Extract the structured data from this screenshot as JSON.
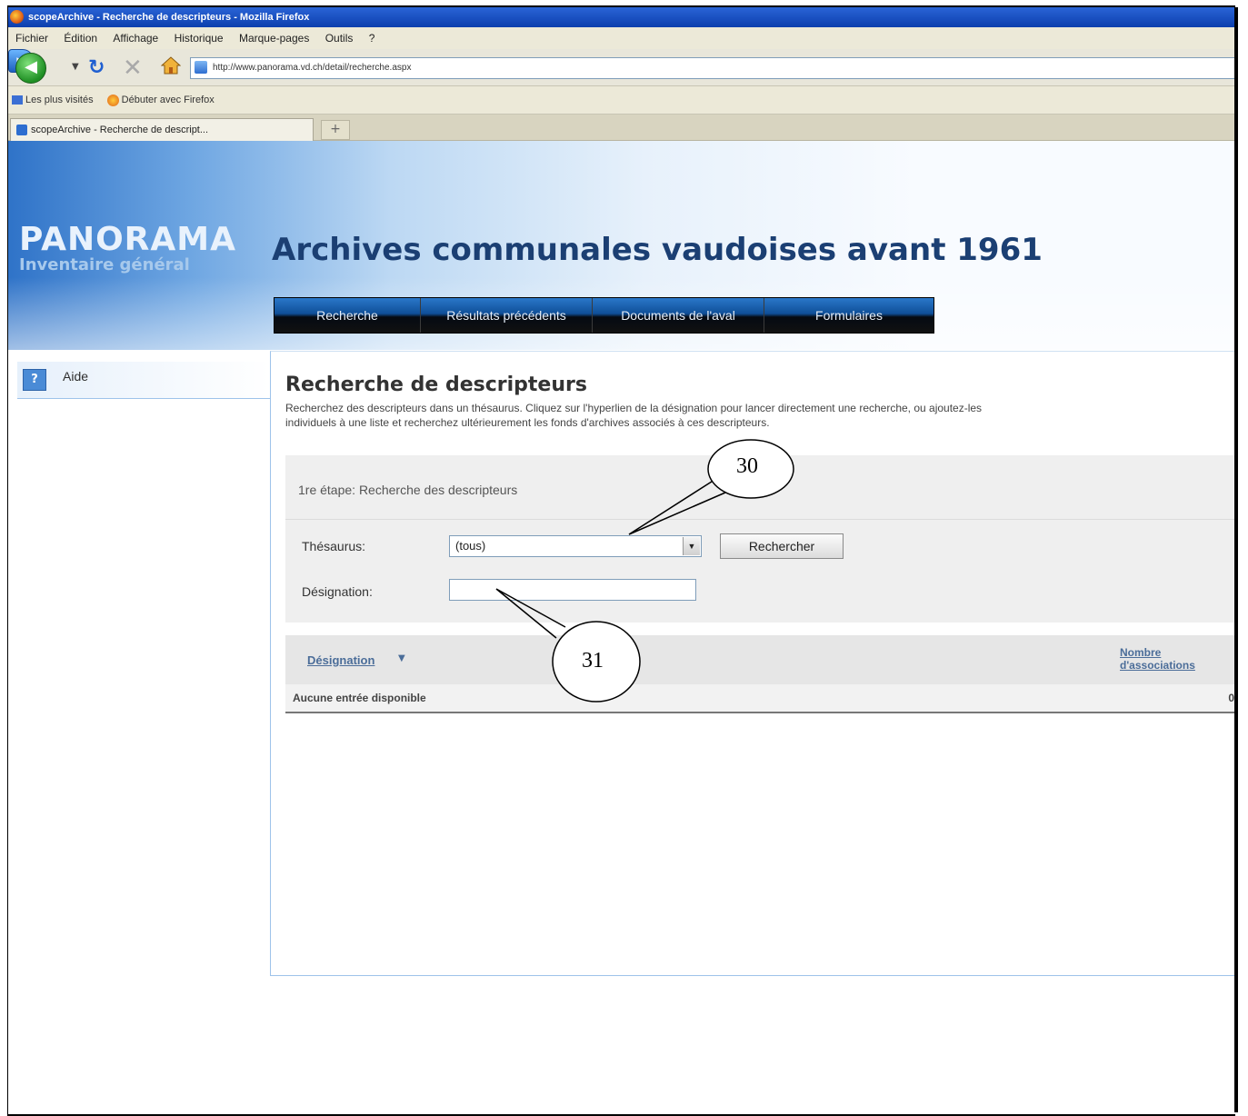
{
  "browser": {
    "window_title": "scopeArchive - Recherche de descripteurs - Mozilla Firefox",
    "menu": [
      "Fichier",
      "Édition",
      "Affichage",
      "Historique",
      "Marque-pages",
      "Outils",
      "?"
    ],
    "url": "http://www.panorama.vd.ch/detail/recherche.aspx",
    "bookmarks": [
      "Les plus visités",
      "Débuter avec Firefox"
    ],
    "active_tab": "scopeArchive - Recherche de descript...",
    "new_tab_label": "+"
  },
  "header": {
    "logo_title": "PANORAMA",
    "logo_subtitle": "Inventaire général",
    "site_title": "Archives communales vaudoises avant 1961",
    "nav": [
      "Recherche",
      "Résultats précédents",
      "Documents de l'aval",
      "Formulaires"
    ]
  },
  "sidebar": {
    "help_label": "Aide"
  },
  "main": {
    "title": "Recherche de descripteurs",
    "description": "Recherchez des descripteurs dans un thésaurus. Cliquez sur l'hyperlien de la désignation pour lancer directement une recherche, ou ajoutez-les",
    "description2": "individuels à une liste et recherchez ultérieurement les fonds d'archives associés à ces descripteurs.",
    "step_label": "1re étape: Recherche des descripteurs",
    "thesaurus_label": "Thésaurus:",
    "thesaurus_value": "(tous)",
    "search_button": "Rechercher",
    "designation_label": "Désignation:",
    "designation_value": "",
    "table": {
      "col_designation": "Désignation",
      "col_count_line1": "Nombre",
      "col_count_line2": "d'associations",
      "empty_text": "Aucune entrée disponible",
      "empty_count": "0"
    }
  },
  "callouts": {
    "c30": "30",
    "c31": "31"
  }
}
